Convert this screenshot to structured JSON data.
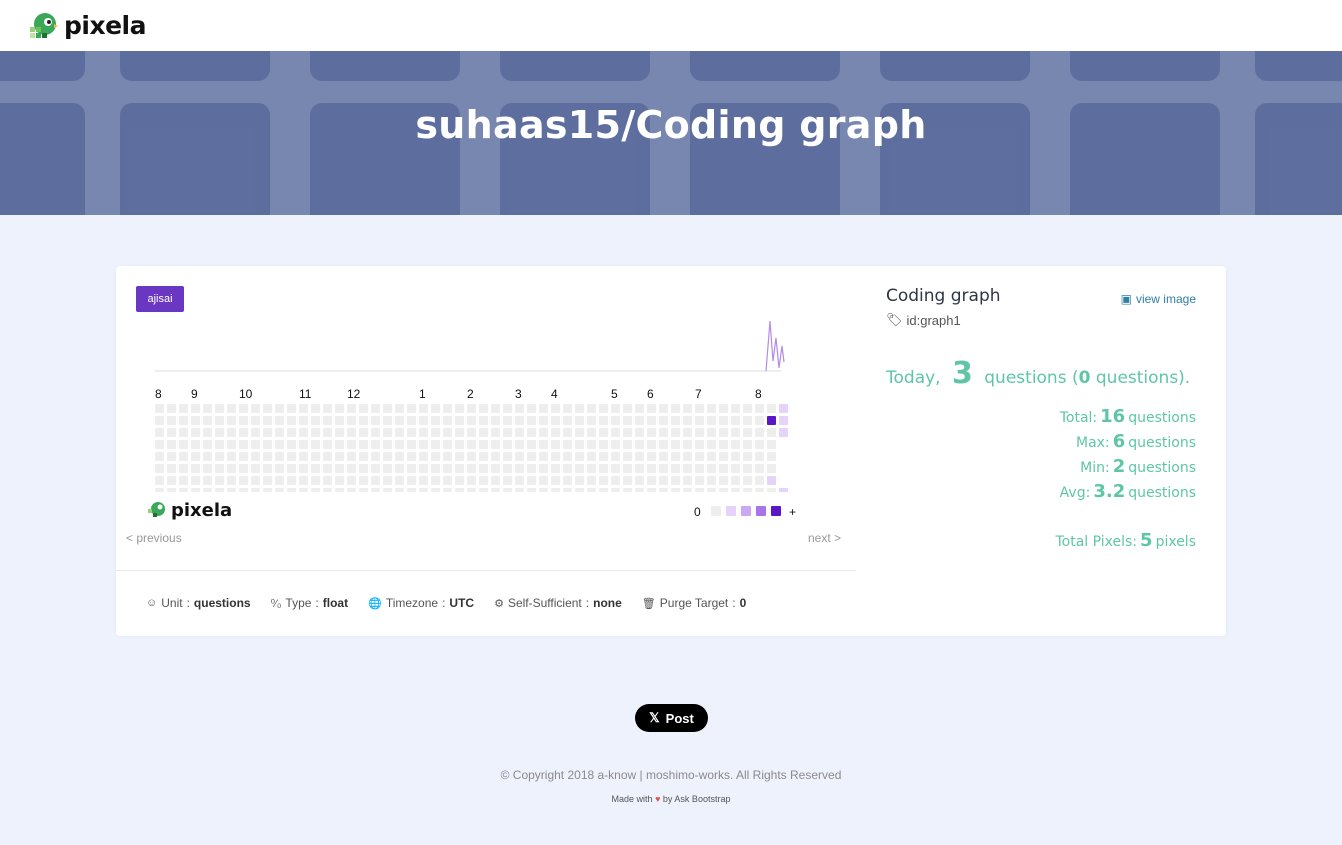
{
  "nav": {
    "logo_text": "pixela"
  },
  "hero": {
    "title": "suhaas15/Coding graph"
  },
  "graph": {
    "badge": "ajisai",
    "months": [
      "8",
      "9",
      "10",
      "11",
      "12",
      "1",
      "2",
      "3",
      "4",
      "5",
      "6",
      "7",
      "8"
    ],
    "logo_text": "pixela",
    "legend_zero": "0",
    "legend_plus": "+",
    "prev_label": "< previous",
    "next_label": "next >",
    "colors": {
      "empty": "#eeeeee",
      "level1": "#e5d3fa",
      "level2": "#cca8f4",
      "level3": "#a774ea",
      "level4": "#5a17c9",
      "line": "#b48be8"
    }
  },
  "meta": {
    "unit_label": "Unit",
    "unit_value": "questions",
    "type_label": "Type",
    "type_value": "float",
    "timezone_label": "Timezone",
    "timezone_value": "UTC",
    "selfsufficient_label": "Self-Sufficient",
    "selfsufficient_value": "none",
    "purge_label": "Purge Target",
    "purge_value": "0",
    "separator": ":"
  },
  "side": {
    "title": "Coding graph",
    "view_image": "view image",
    "graph_id": "id:graph1",
    "today_prefix": "Today",
    "today_value": "3",
    "today_unit": "questions",
    "today_paren_open": "(",
    "today_paren_value": "0",
    "today_paren_close": "questions).",
    "total_label": "Total:",
    "total_value": "16",
    "max_label": "Max:",
    "max_value": "6",
    "min_label": "Min:",
    "min_value": "2",
    "avg_label": "Avg:",
    "avg_value": "3.2",
    "unit": "questions",
    "pixels_label": "Total Pixels:",
    "pixels_value": "5",
    "pixels_unit": "pixels"
  },
  "footer": {
    "post_label": "Post",
    "copyright": "© Copyright 2018 a-know | moshimo-works. All Rights Reserved",
    "made_prefix": "Made with",
    "made_suffix": "by Ask Bootstrap"
  }
}
